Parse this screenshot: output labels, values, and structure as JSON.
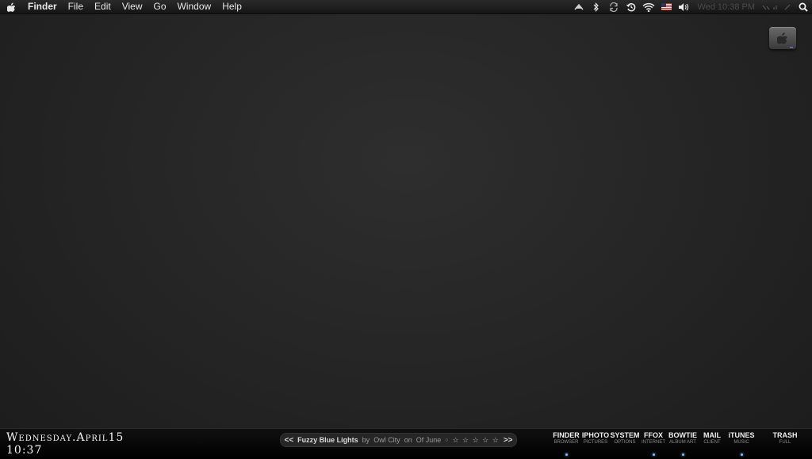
{
  "menubar": {
    "app_name": "Finder",
    "menus": [
      "File",
      "Edit",
      "View",
      "Go",
      "Window",
      "Help"
    ],
    "clock": "Wed 10:38 PM",
    "status_icons": [
      "dashboard-icon",
      "bluetooth-icon",
      "sync-icon",
      "time-machine-icon",
      "wifi-icon",
      "us-flag-icon",
      "volume-icon"
    ],
    "search_icon": "spotlight-search-icon"
  },
  "desktop": {
    "drive_icon": "hard-drive-icon"
  },
  "bottom": {
    "date": "Wednesday.April15",
    "time": "10:37",
    "now_playing": {
      "prev": "<<",
      "song": "Fuzzy Blue Lights",
      "by": "by",
      "artist": "Owl City",
      "on": "on",
      "album": "Of June",
      "rating": "☆ ☆ ☆ ☆ ☆",
      "next": ">>"
    },
    "dock": [
      {
        "label": "FINDER",
        "sub": "BROWSER",
        "running": true
      },
      {
        "label": "IPHOTO",
        "sub": "PICTURES",
        "running": false
      },
      {
        "label": "SYSTEM",
        "sub": "OPTIONS",
        "running": false
      },
      {
        "label": "FFOX",
        "sub": "INTERNET",
        "running": true
      },
      {
        "label": "BOWTIE",
        "sub": "ALBUM ART",
        "running": true
      },
      {
        "label": "MAIL",
        "sub": "CLIENT",
        "running": false
      },
      {
        "label": "iTUNES",
        "sub": "MUSIC",
        "running": true
      },
      {
        "label": "TRASH",
        "sub": "FULL",
        "running": false
      }
    ]
  }
}
